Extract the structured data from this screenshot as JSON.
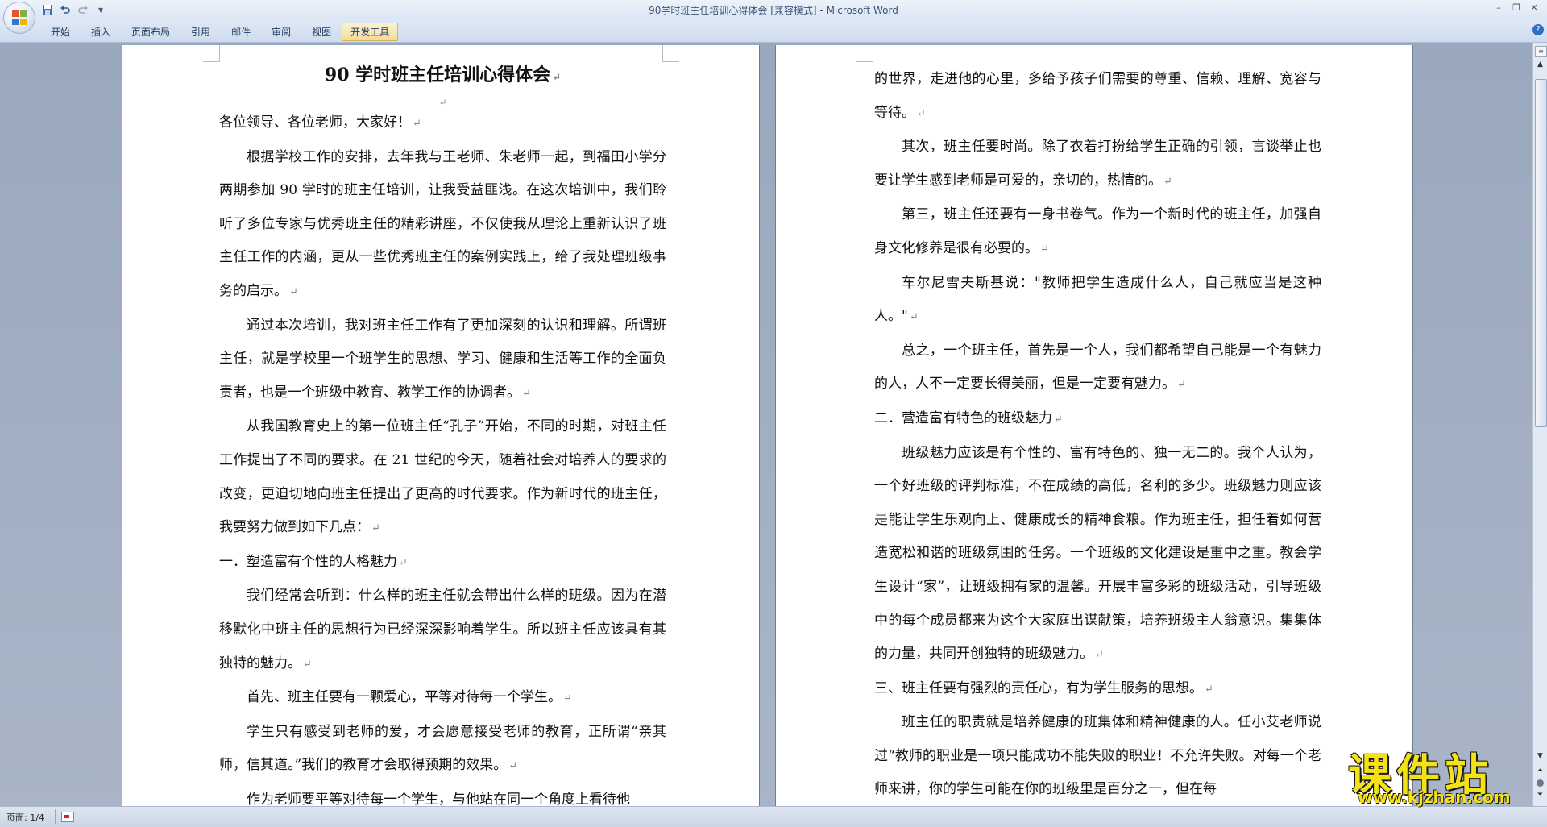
{
  "window": {
    "title": "90学时班主任培训心得体会 [兼容模式] - Microsoft Word"
  },
  "ribbon": {
    "tabs": [
      "开始",
      "插入",
      "页面布局",
      "引用",
      "邮件",
      "审阅",
      "视图",
      "开发工具"
    ],
    "active_tab": "开发工具"
  },
  "status": {
    "page": "页面: 1/4"
  },
  "document": {
    "title": "90 学时班主任培训心得体会",
    "page1": [
      "各位领导、各位老师，大家好！",
      "根据学校工作的安排，去年我与王老师、朱老师一起，到福田小学分两期参加 90 学时的班主任培训，让我受益匪浅。在这次培训中，我们聆听了多位专家与优秀班主任的精彩讲座，不仅使我从理论上重新认识了班主任工作的内涵，更从一些优秀班主任的案例实践上，给了我处理班级事务的启示。",
      "通过本次培训，我对班主任工作有了更加深刻的认识和理解。所谓班主任，就是学校里一个班学生的思想、学习、健康和生活等工作的全面负责者，也是一个班级中教育、教学工作的协调者。",
      "从我国教育史上的第一位班主任“孔子”开始，不同的时期，对班主任工作提出了不同的要求。在 21 世纪的今天，随着社会对培养人的要求的改变，更迫切地向班主任提出了更高的时代要求。作为新时代的班主任，我要努力做到如下几点：",
      "一．塑造富有个性的人格魅力",
      "我们经常会听到：什么样的班主任就会带出什么样的班级。因为在潜移默化中班主任的思想行为已经深深影响着学生。所以班主任应该具有其独特的魅力。",
      "首先、班主任要有一颗爱心，平等对待每一个学生。",
      "学生只有感受到老师的爱，才会愿意接受老师的教育，正所谓“亲其师，信其道。”我们的教育才会取得预期的效果。",
      "作为老师要平等对待每一个学生，与他站在同一个角度上看待他"
    ],
    "page2": [
      "的世界，走进他的心里，多给予孩子们需要的尊重、信赖、理解、宽容与等待。",
      "其次，班主任要时尚。除了衣着打扮给学生正确的引领，言谈举止也要让学生感到老师是可爱的，亲切的，热情的。",
      "第三，班主任还要有一身书卷气。作为一个新时代的班主任，加强自身文化修养是很有必要的。",
      "车尔尼雪夫斯基说：\"教师把学生造成什么人，自己就应当是这种人。\"",
      "总之，一个班主任，首先是一个人，我们都希望自己能是一个有魅力的人，人不一定要长得美丽，但是一定要有魅力。",
      "二．营造富有特色的班级魅力",
      "班级魅力应该是有个性的、富有特色的、独一无二的。我个人认为，一个好班级的评判标准，不在成绩的高低，名利的多少。班级魅力则应该是能让学生乐观向上、健康成长的精神食粮。作为班主任，担任着如何营造宽松和谐的班级氛围的任务。一个班级的文化建设是重中之重。教会学生设计“家”，让班级拥有家的温馨。开展丰富多彩的班级活动，引导班级中的每个成员都来为这个大家庭出谋献策，培养班级主人翁意识。集集体的力量，共同开创独特的班级魅力。",
      "三、班主任要有强烈的责任心，有为学生服务的思想。",
      "班主任的职责就是培养健康的班集体和精神健康的人。任小艾老师说过“教师的职业是一项只能成功不能失败的职业！不允许失败。对每一个老师来讲，你的学生可能在你的班级里是百分之一，但在每"
    ]
  },
  "watermark": {
    "main": "课件站",
    "url": "www.kjzhan.com"
  },
  "icons": {
    "office": "office-logo-icon",
    "save": "save-icon",
    "undo": "undo-icon",
    "redo": "redo-icon",
    "customize": "qat-dropdown-icon",
    "help": "help-icon"
  }
}
